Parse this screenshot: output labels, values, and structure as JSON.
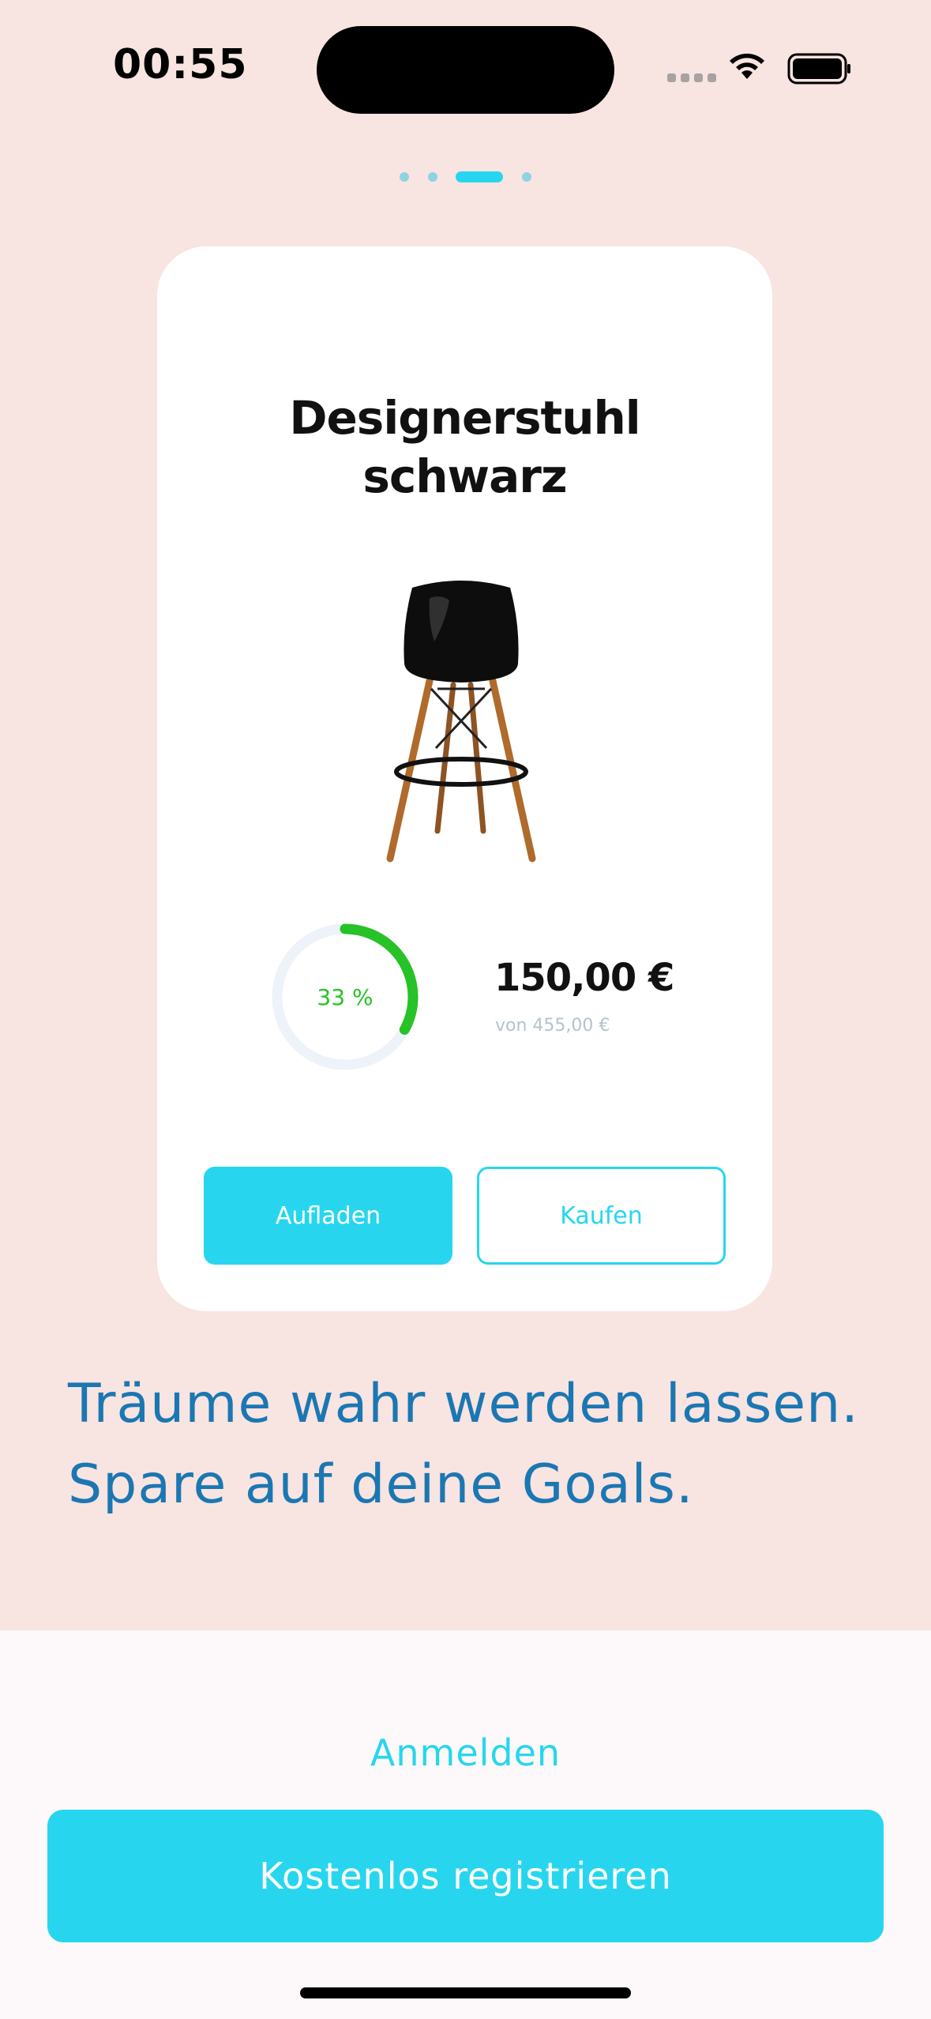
{
  "status_bar": {
    "time": "00:55"
  },
  "onboarding": {
    "page_count": 4,
    "active_page": 3
  },
  "product_card": {
    "title_line1": "Designerstuhl",
    "title_line2": "schwarz",
    "progress_percent": 33,
    "progress_label": "33 %",
    "saved_amount": "150,00 €",
    "target_amount": "von 455,00 €",
    "topup_button": "Aufladen",
    "buy_button": "Kaufen"
  },
  "tagline": {
    "line1": "Träume wahr werden lassen.",
    "line2": "Spare auf deine Goals."
  },
  "actions": {
    "login_label": "Anmelden",
    "register_label": "Kostenlos registrieren"
  },
  "colors": {
    "background": "#f8e4e1",
    "accent": "#27d6ee",
    "progress": "#27c227",
    "tagline": "#1b77b2"
  }
}
